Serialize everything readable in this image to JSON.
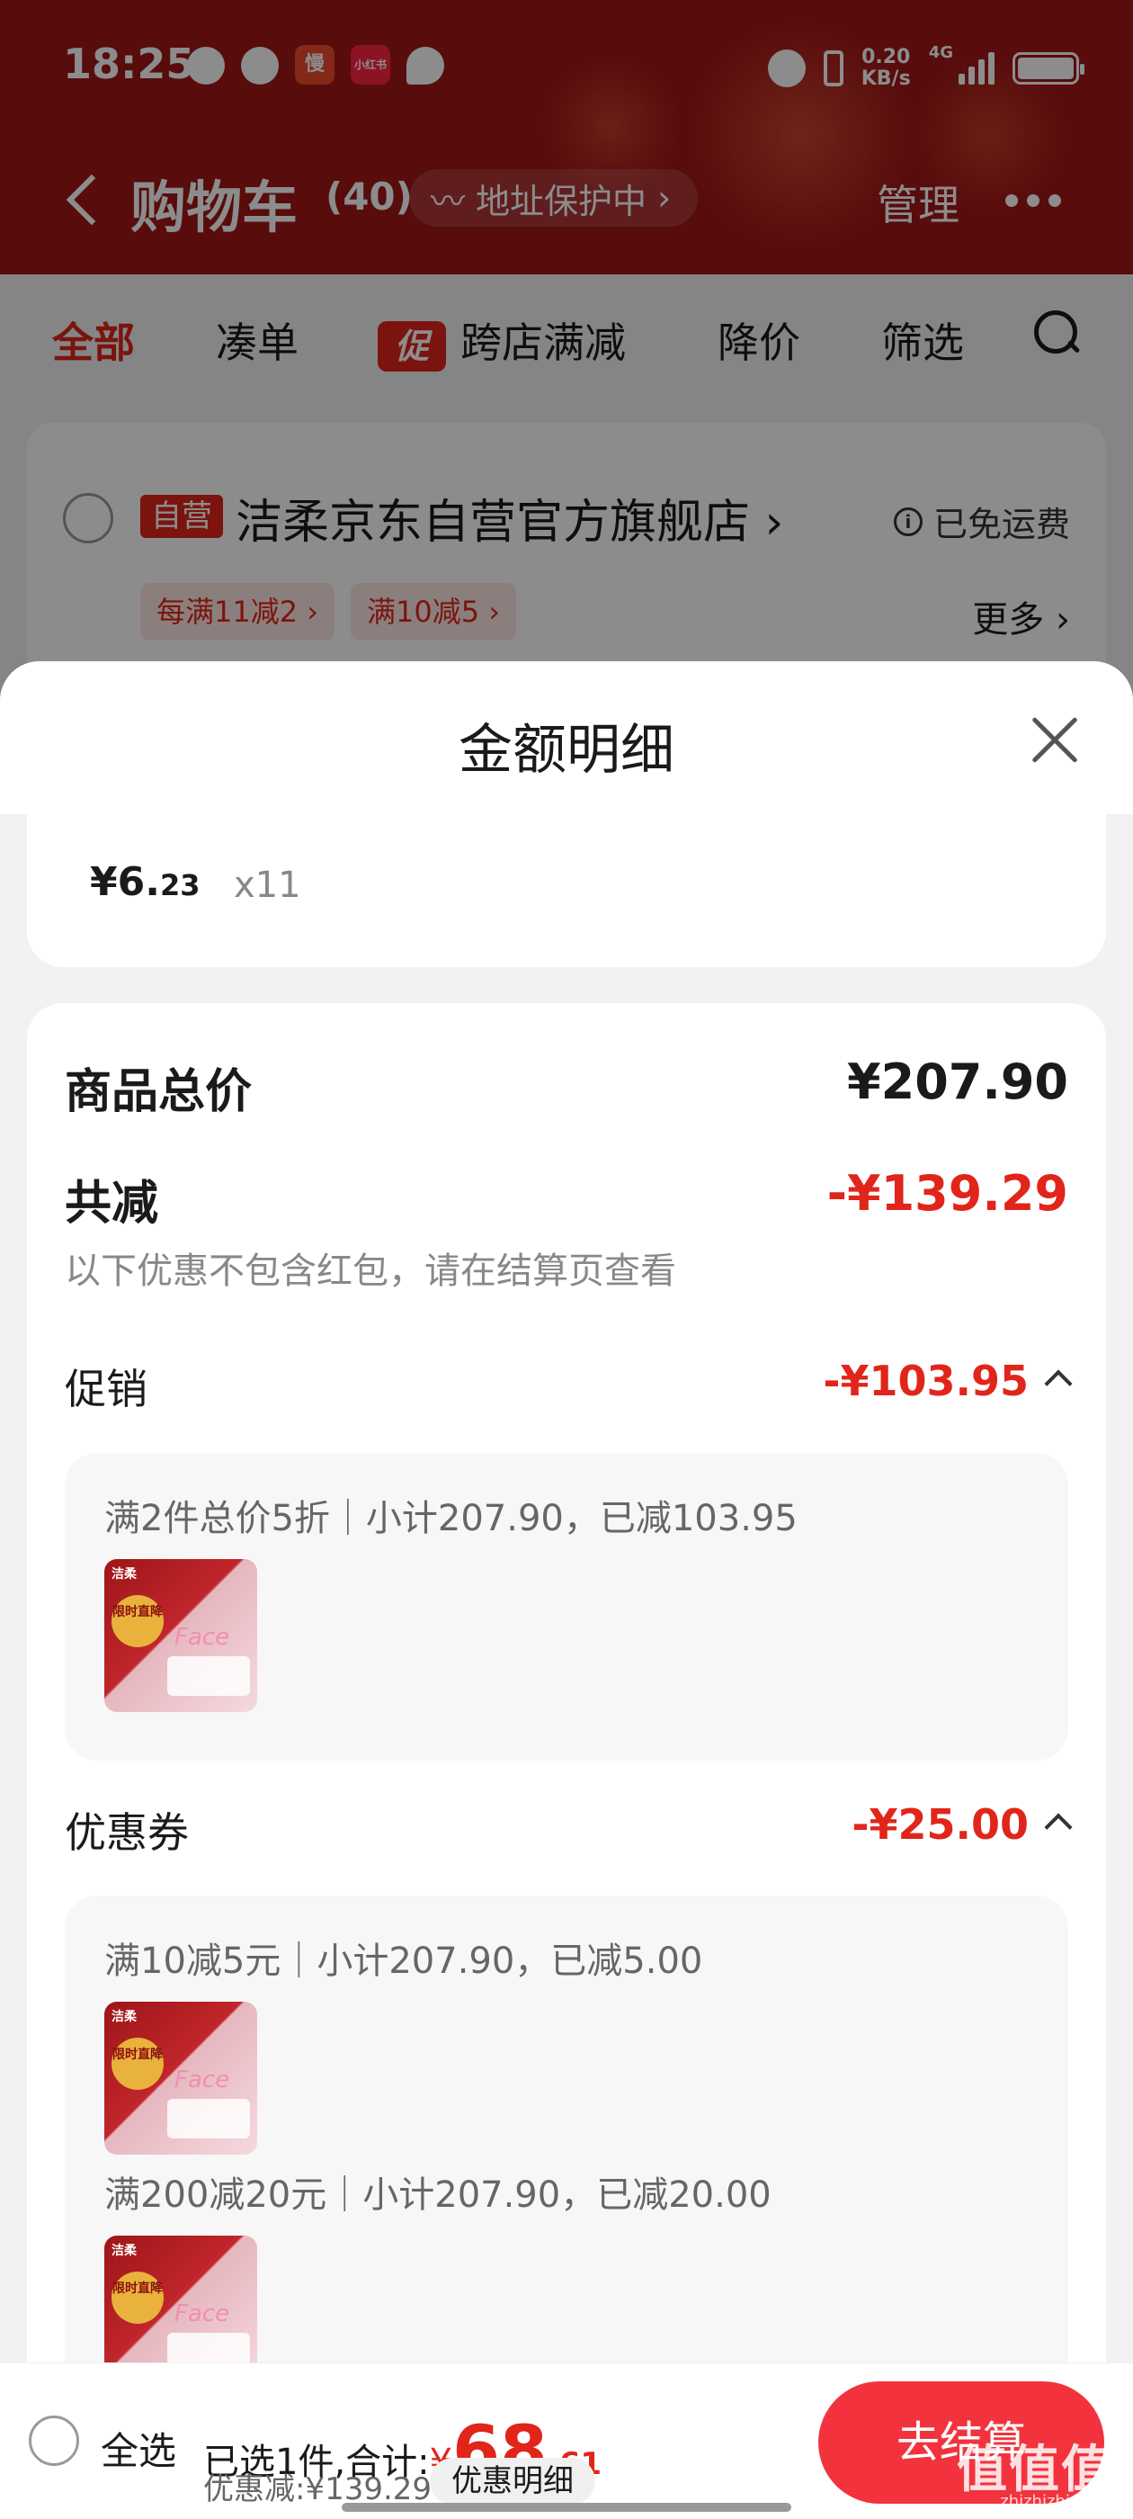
{
  "status_bar": {
    "time": "18:25",
    "speed": "0.20",
    "speed_unit": "KB/s",
    "network": "4G",
    "app_badge_1": "慢",
    "app_badge_2": "小红书"
  },
  "navbar": {
    "title": "购物车",
    "count": "(40)",
    "address_pill": "地址保护中",
    "manage": "管理"
  },
  "tabs": {
    "all": "全部",
    "bundle": "凑单",
    "promo_badge": "促",
    "cross_store": "跨店满减",
    "price_drop": "降价",
    "filter": "筛选"
  },
  "shop": {
    "self_badge": "自营",
    "name": "洁柔京东自营官方旗舰店",
    "shipping": "已免运费",
    "chips": [
      "每满11减2",
      "满10减5"
    ],
    "more": "更多"
  },
  "sheet": {
    "title": "金额明细",
    "item": {
      "currency": "¥",
      "price_int": "6.",
      "price_dec": "23",
      "quantity": "x11"
    },
    "total": {
      "label": "商品总价",
      "value": "¥207.90"
    },
    "reduce": {
      "label": "共减",
      "value": "-¥139.29",
      "note": "以下优惠不包含红包，请在结算页查看"
    },
    "promotion": {
      "label": "促销",
      "value": "-¥103.95",
      "rules": [
        "满2件总价5折｜小计207.90，已减103.95"
      ]
    },
    "coupon": {
      "label": "优惠券",
      "value": "-¥25.00",
      "rules": [
        "满10减5元｜小计207.90，已减5.00",
        "满200减20元｜小计207.90，已减20.00"
      ]
    },
    "thumb": {
      "brand": "洁柔",
      "sale": "限时直降",
      "product": "Face"
    }
  },
  "bottom_bar": {
    "select_all": "全选",
    "summary_prefix": "已选1件,合计:",
    "currency": "¥",
    "total_int": "68",
    "total_dec": ".61",
    "discount": "优惠减:¥139.29",
    "detail_button": "优惠明细",
    "checkout": "去结算"
  },
  "watermark": {
    "main": "值值值",
    "sub": "zhizhizhi.com"
  },
  "colors": {
    "header_red": "#a01616",
    "accent_red": "#e1251b",
    "checkout_red": "#f2333e"
  }
}
